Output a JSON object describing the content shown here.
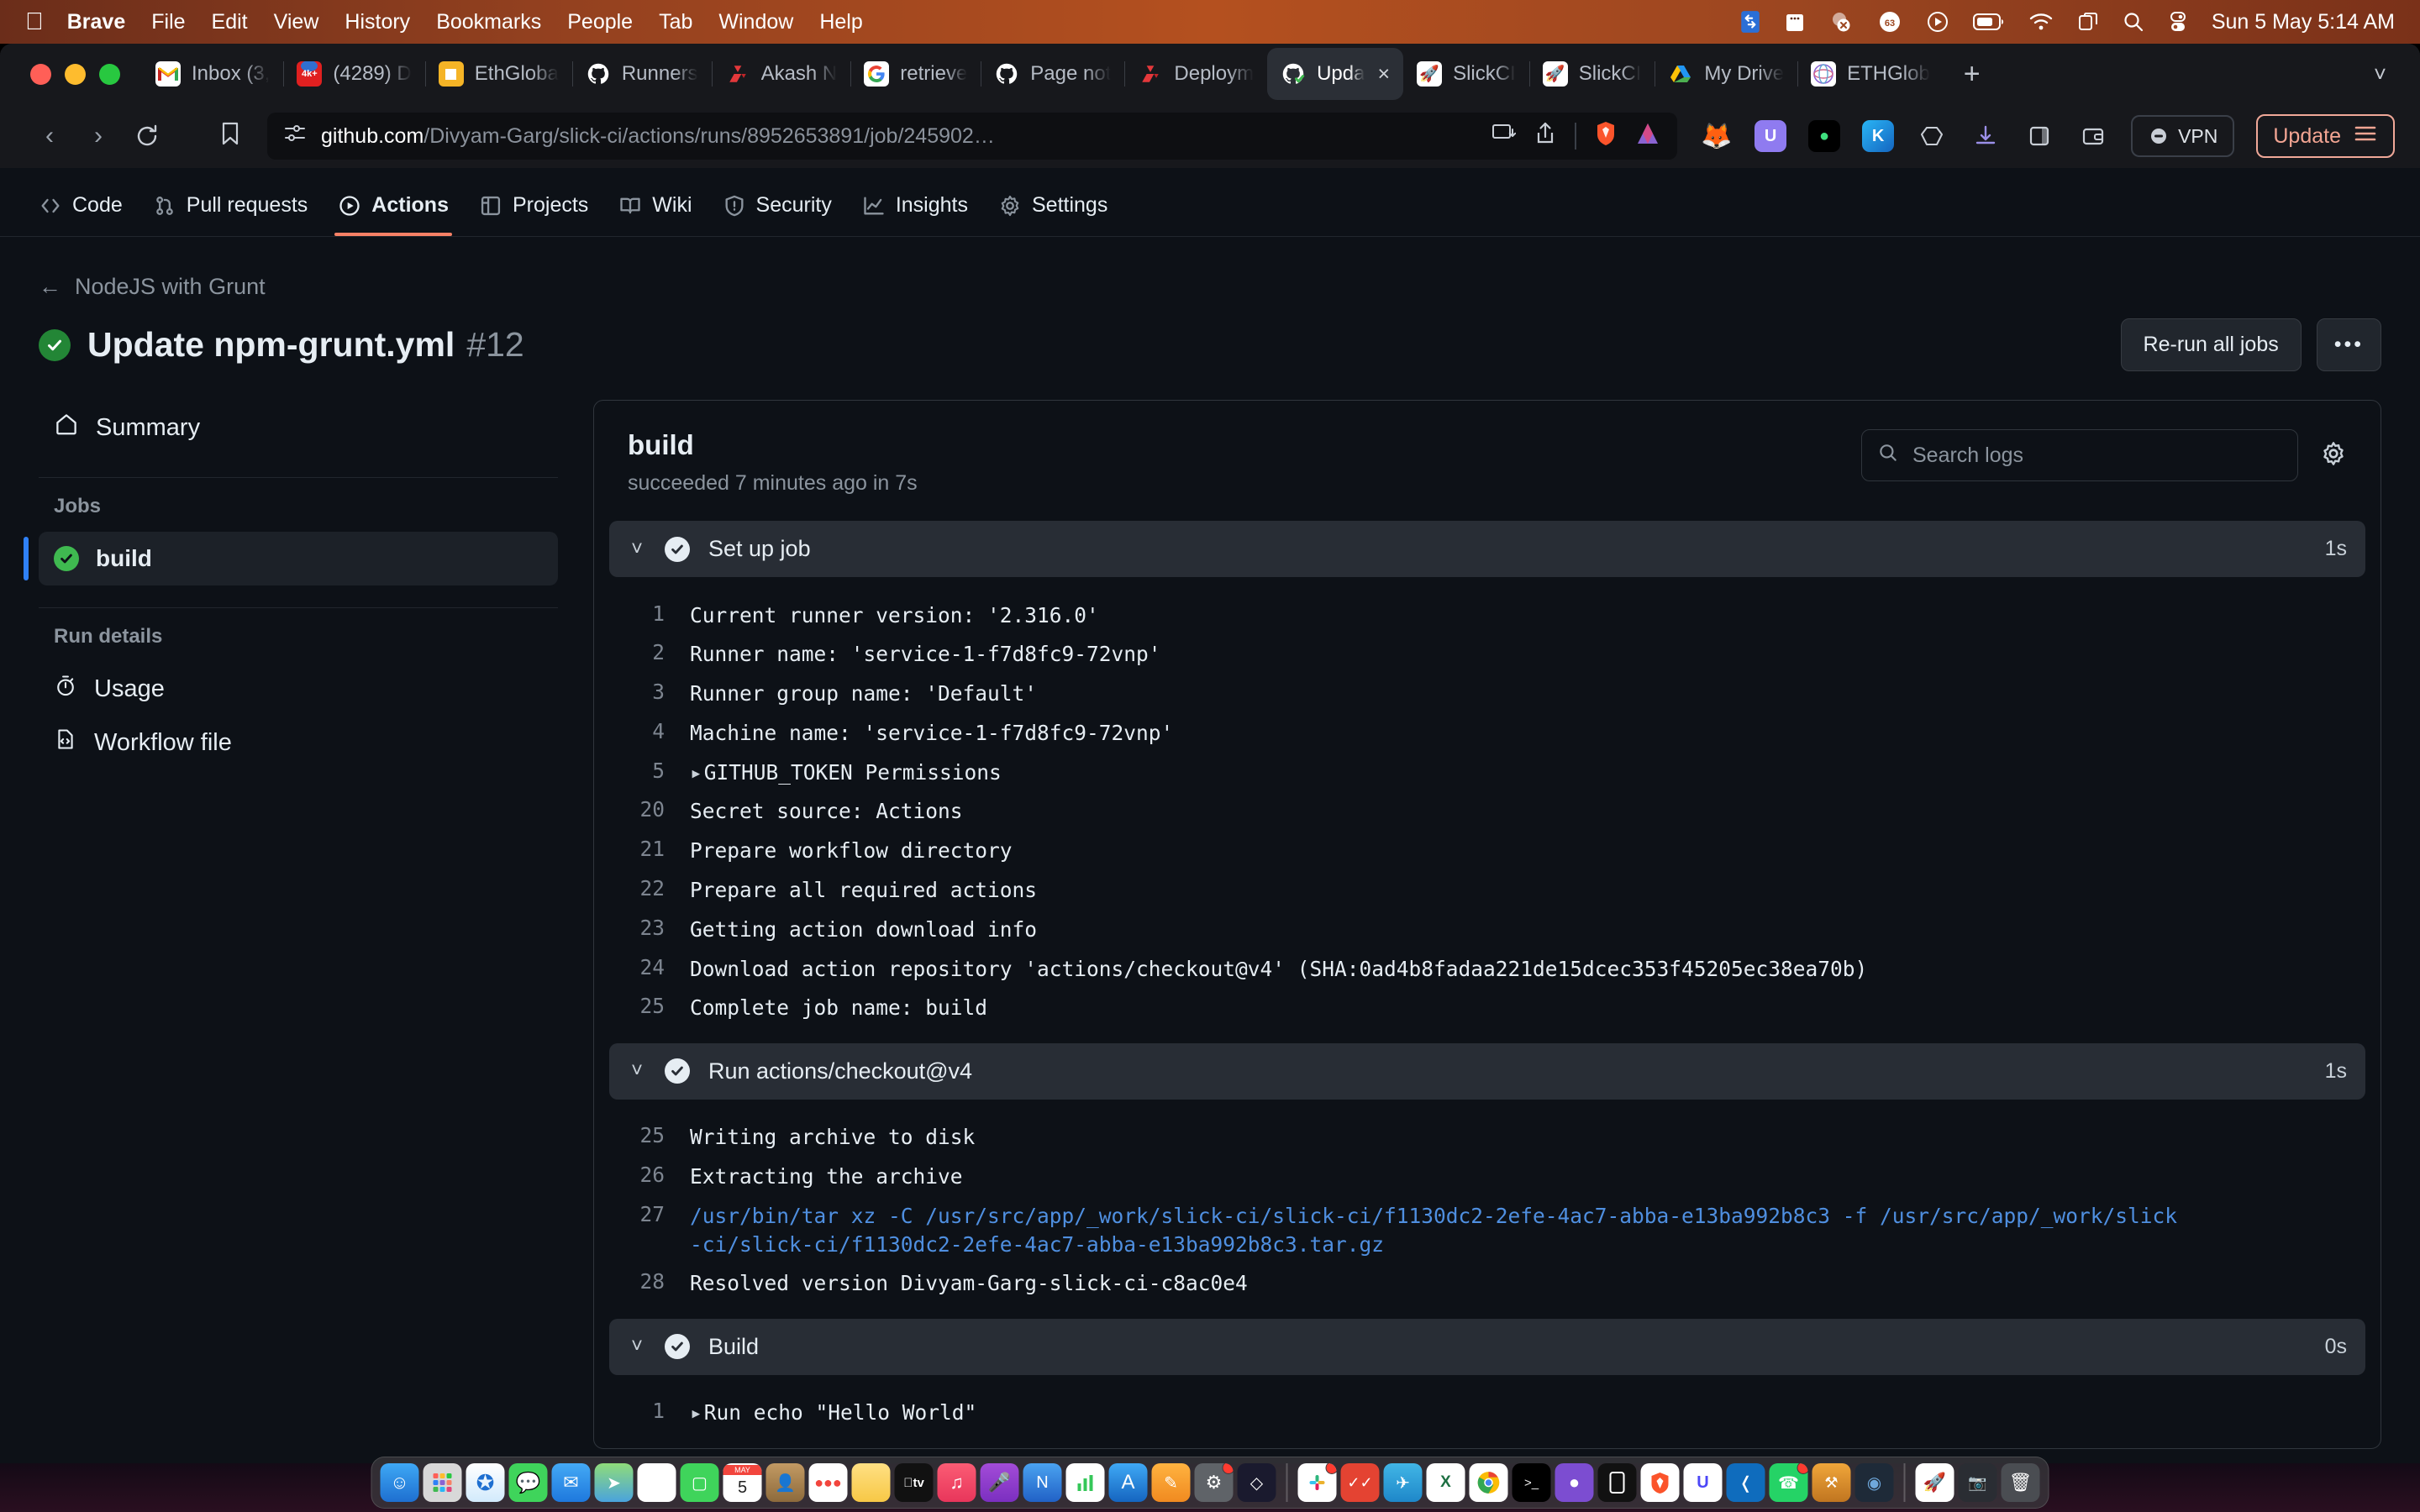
{
  "menubar": {
    "apple_icon": "apple-logo-icon",
    "items": [
      {
        "label": "Brave",
        "bold": true
      },
      {
        "label": "File",
        "bold": false
      },
      {
        "label": "Edit",
        "bold": false
      },
      {
        "label": "View",
        "bold": false
      },
      {
        "label": "History",
        "bold": false
      },
      {
        "label": "Bookmarks",
        "bold": false
      },
      {
        "label": "People",
        "bold": false
      },
      {
        "label": "Tab",
        "bold": false
      },
      {
        "label": "Window",
        "bold": false
      },
      {
        "label": "Help",
        "bold": false
      }
    ],
    "status_icons": [
      "screen-mirroring-icon",
      "notes-icon",
      "do-not-disturb-icon",
      "battery-percent-63-icon",
      "playback-icon",
      "battery-icon",
      "wifi-icon",
      "window-switcher-icon",
      "spotlight-search-icon",
      "control-center-icon"
    ],
    "battery_percent": "63",
    "clock": "Sun 5 May  5:14 AM"
  },
  "browser": {
    "tabs": [
      {
        "label": "Inbox (3,",
        "favicon": "gmail-icon"
      },
      {
        "label": "(4289) D",
        "favicon": "youtube-4k-icon",
        "badge": "4k+"
      },
      {
        "label": "EthGloba",
        "favicon": "ethglobal-icon"
      },
      {
        "label": "Runners",
        "favicon": "github-icon"
      },
      {
        "label": "Akash N",
        "favicon": "akash-icon"
      },
      {
        "label": "retrieve",
        "favicon": "google-icon"
      },
      {
        "label": "Page not",
        "favicon": "github-icon"
      },
      {
        "label": "Deploym",
        "favicon": "akash-icon"
      },
      {
        "label": "Upda",
        "favicon": "github-check-icon",
        "active": true,
        "close": "×"
      },
      {
        "label": "SlickCI",
        "favicon": "rocket-icon"
      },
      {
        "label": "SlickCI",
        "favicon": "rocket-icon"
      },
      {
        "label": "My Drive",
        "favicon": "google-drive-icon"
      },
      {
        "label": "ETHGlob",
        "favicon": "ethglobal-ring-icon"
      }
    ],
    "new_tab_label": "+",
    "tab_list_chevron": "chevron-down-icon",
    "nav": {
      "back": "back-arrow-icon",
      "forward": "forward-arrow-icon",
      "reload": "reload-icon",
      "bookmark": "bookmark-icon"
    },
    "omnibox": {
      "site_settings_icon": "tune-icon",
      "url_host": "github.com",
      "url_path": "/Divyam-Garg/slick-ci/actions/runs/8952653891/job/245902…",
      "cast_icon": "cast-icon",
      "share_icon": "share-icon",
      "brave_shields_icon": "brave-shields-icon",
      "brave_leo_icon": "brave-leo-icon"
    },
    "extensions": [
      "metamask-icon",
      "unstoppable-icon",
      "phantom-icon",
      "keplr-icon",
      "kepler-wallet-icon",
      "downloads-icon",
      "sidebar-icon",
      "wallet-icon"
    ],
    "vpn_label": "VPN",
    "update_label": "Update",
    "menu_icon": "hamburger-menu-icon"
  },
  "github": {
    "nav": [
      {
        "label": "Code",
        "icon": "code-icon",
        "active": false
      },
      {
        "label": "Pull requests",
        "icon": "git-pull-request-icon",
        "active": false
      },
      {
        "label": "Actions",
        "icon": "play-circle-icon",
        "active": true
      },
      {
        "label": "Projects",
        "icon": "project-board-icon",
        "active": false
      },
      {
        "label": "Wiki",
        "icon": "book-icon",
        "active": false
      },
      {
        "label": "Security",
        "icon": "shield-icon",
        "active": false
      },
      {
        "label": "Insights",
        "icon": "graph-icon",
        "active": false
      },
      {
        "label": "Settings",
        "icon": "gear-icon",
        "active": false
      }
    ],
    "back_link": "NodeJS with Grunt",
    "back_icon": "arrow-left-icon",
    "run_status_icon": "success-check-icon",
    "run_title": "Update npm-grunt.yml",
    "run_number": "#12",
    "rerun_button": "Re-run all jobs",
    "kebab_button": "•••",
    "sidebar": {
      "summary": {
        "label": "Summary",
        "icon": "home-icon"
      },
      "jobs_heading": "Jobs",
      "jobs": [
        {
          "label": "build",
          "status": "success"
        }
      ],
      "run_details_heading": "Run details",
      "run_details": [
        {
          "label": "Usage",
          "icon": "stopwatch-icon"
        },
        {
          "label": "Workflow file",
          "icon": "workflow-file-icon"
        }
      ]
    },
    "log": {
      "job_name": "build",
      "job_status": "succeeded 7 minutes ago in 7s",
      "search_placeholder": "Search logs",
      "search_icon": "search-icon",
      "settings_icon": "gear-icon",
      "steps": [
        {
          "name": "Set up job",
          "duration": "1s",
          "status": "success",
          "lines": [
            {
              "n": "1",
              "text": "Current runner version: '2.316.0'"
            },
            {
              "n": "2",
              "text": "Runner name: 'service-1-f7d8fc9-72vnp'"
            },
            {
              "n": "3",
              "text": "Runner group name: 'Default'"
            },
            {
              "n": "4",
              "text": "Machine name: 'service-1-f7d8fc9-72vnp'"
            },
            {
              "n": "5",
              "text": "GITHUB_TOKEN Permissions",
              "collapsed": true
            },
            {
              "n": "20",
              "text": "Secret source: Actions"
            },
            {
              "n": "21",
              "text": "Prepare workflow directory"
            },
            {
              "n": "22",
              "text": "Prepare all required actions"
            },
            {
              "n": "23",
              "text": "Getting action download info"
            },
            {
              "n": "24",
              "text": "Download action repository 'actions/checkout@v4' (SHA:0ad4b8fadaa221de15dcec353f45205ec38ea70b)"
            },
            {
              "n": "25",
              "text": "Complete job name: build"
            }
          ]
        },
        {
          "name": "Run actions/checkout@v4",
          "duration": "1s",
          "status": "success",
          "lines": [
            {
              "n": "25",
              "text": "Writing archive to disk"
            },
            {
              "n": "26",
              "text": "Extracting the archive"
            },
            {
              "n": "27",
              "text": "/usr/bin/tar xz -C /usr/src/app/_work/slick-ci/slick-ci/f1130dc2-2efe-4ac7-abba-e13ba992b8c3 -f /usr/src/app/_work/slick-ci/slick-ci/f1130dc2-2efe-4ac7-abba-e13ba992b8c3.tar.gz",
              "link": true
            },
            {
              "n": "28",
              "text": "Resolved version Divyam-Garg-slick-ci-c8ac0e4"
            }
          ]
        },
        {
          "name": "Build",
          "duration": "0s",
          "status": "success",
          "lines": [
            {
              "n": "1",
              "text": "Run echo \"Hello World\"",
              "collapsed": true
            }
          ]
        }
      ]
    }
  },
  "dock": {
    "calendar_month": "MAY",
    "calendar_day": "5",
    "icons": [
      "finder-icon",
      "launchpad-icon",
      "safari-icon",
      "messages-icon",
      "mail-icon",
      "maps-icon",
      "photos-icon",
      "facetime-icon",
      "calendar-icon",
      "contacts-icon",
      "reminders-icon",
      "notes-icon",
      "appletv-icon",
      "music-icon",
      "podcasts-icon",
      "news-icon",
      "numbers-icon",
      "appstore-icon",
      "pages-icon",
      "settings-icon",
      "keynote-icon",
      "slack-icon",
      "todoist-icon",
      "telegram-icon",
      "excel-icon",
      "chrome-icon",
      "terminal-icon",
      "github-icon",
      "iphone-mirroring-icon",
      "brave-icon",
      "unstoppable-icon",
      "vscode-icon",
      "whatsapp-icon",
      "xcode-icon",
      "arc-icon",
      "postman-icon",
      "finder-window-icon",
      "screenshot-icon",
      "trash-icon"
    ]
  },
  "colors": {
    "accent_success": "#3fb950",
    "accent_tab": "#f78166",
    "link": "#4f8fe0",
    "selected_bar": "#2f81f7",
    "page_bg": "#0d1117"
  }
}
